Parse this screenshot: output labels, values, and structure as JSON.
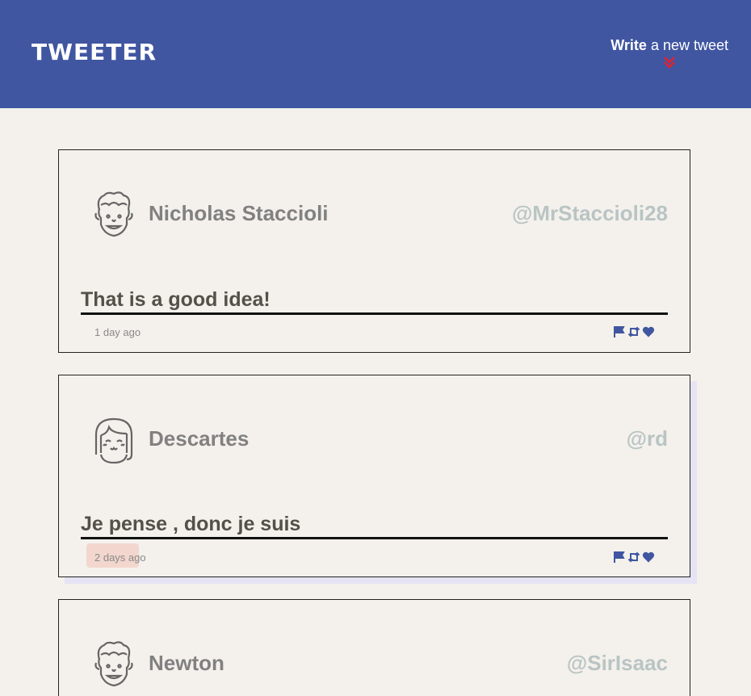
{
  "nav": {
    "logo": "TWEETER",
    "write_bold": "Write",
    "write_rest": " a new tweet"
  },
  "colors": {
    "nav_bg": "#4056a1",
    "accent_chevron": "#e0232f",
    "action_icons": "#4056a1"
  },
  "tweets": [
    {
      "name": "Nicholas Staccioli",
      "handle": "@MrStaccioli28",
      "text": "That is a good idea!",
      "time": "1 day ago",
      "avatar_icon": "curly-hair-avatar-icon"
    },
    {
      "name": "Descartes",
      "handle": "@rd",
      "text": "Je pense , donc je suis",
      "time": "2 days ago",
      "avatar_icon": "bob-hair-avatar-icon"
    },
    {
      "name": "Newton",
      "handle": "@SirIsaac",
      "text": "",
      "time": "",
      "avatar_icon": "curly-hair-avatar-icon"
    }
  ]
}
